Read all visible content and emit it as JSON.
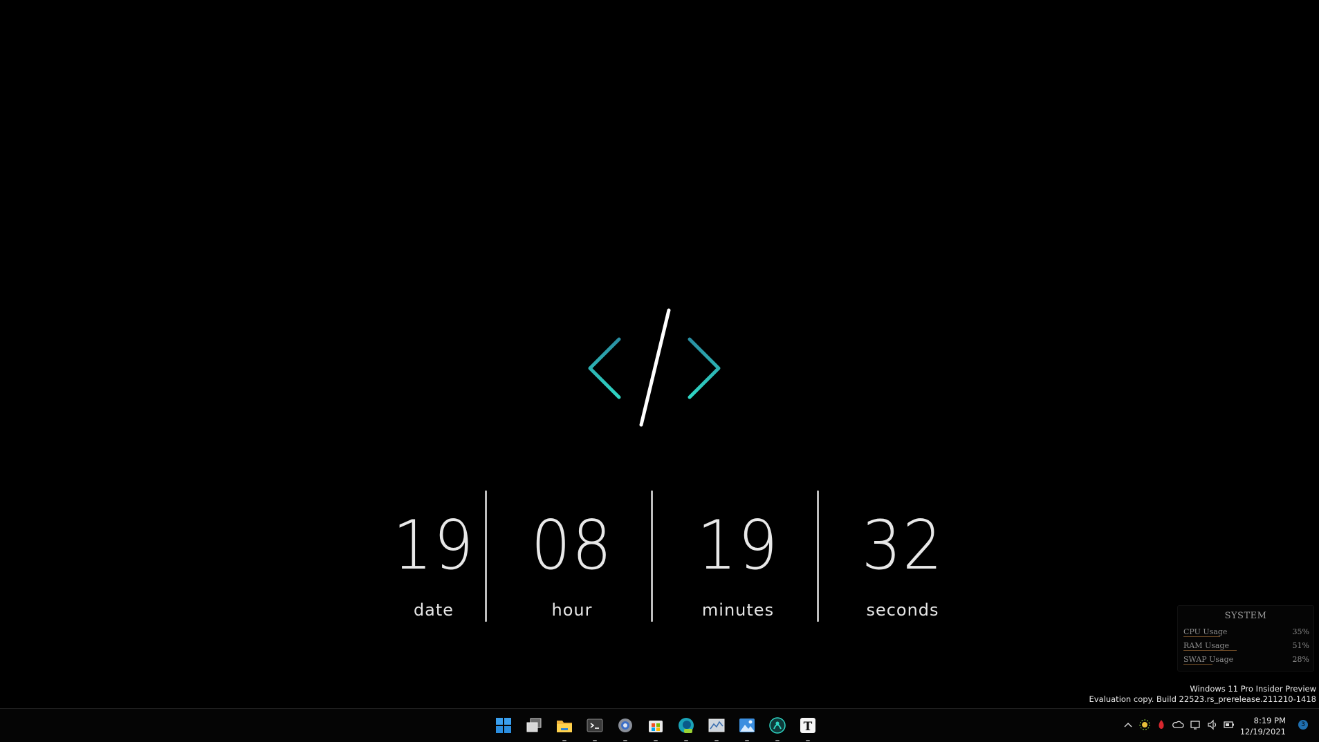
{
  "clock": {
    "segments": [
      {
        "value": "19",
        "label": "date"
      },
      {
        "value": "08",
        "label": "hour"
      },
      {
        "value": "19",
        "label": "minutes"
      },
      {
        "value": "32",
        "label": "seconds"
      }
    ]
  },
  "colors": {
    "background": "#000000",
    "accent_teal": "#2fd6c4",
    "accent_teal_dark": "#2a8fa3",
    "text": "#e8e8e8"
  },
  "system_widget": {
    "title": "SYSTEM",
    "rows": [
      {
        "name": "CPU Usage",
        "percent": "35%",
        "fraction": 0.35
      },
      {
        "name": "RAM Usage",
        "percent": "51%",
        "fraction": 0.51
      },
      {
        "name": "SWAP Usage",
        "percent": "28%",
        "fraction": 0.28
      }
    ]
  },
  "watermark": {
    "line1": "Windows 11 Pro Insider Preview",
    "line2": "Evaluation copy. Build 22523.rs_prerelease.211210-1418"
  },
  "taskbar": {
    "apps": [
      {
        "name": "start-icon"
      },
      {
        "name": "task-view-icon"
      },
      {
        "name": "file-explorer-icon"
      },
      {
        "name": "terminal-icon"
      },
      {
        "name": "settings-icon"
      },
      {
        "name": "store-icon"
      },
      {
        "name": "edge-dev-icon"
      },
      {
        "name": "system-monitor-icon"
      },
      {
        "name": "photos-icon"
      },
      {
        "name": "app-icon"
      },
      {
        "name": "typora-icon"
      }
    ],
    "tray_time": "8:19 PM",
    "tray_date": "12/19/2021",
    "notification_count": "3"
  }
}
